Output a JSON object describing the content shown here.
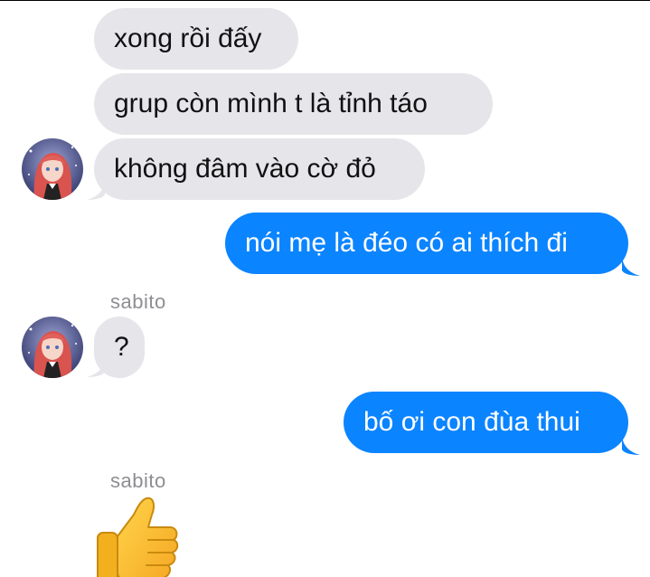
{
  "conversation": {
    "messages": [
      {
        "direction": "in",
        "text": "xong rồi đấy"
      },
      {
        "direction": "in",
        "text": "grup còn mình t là tỉnh táo"
      },
      {
        "direction": "in",
        "text": "không đâm vào cờ đỏ"
      },
      {
        "direction": "out",
        "text": "nói mẹ là đéo có ai thích đi"
      },
      {
        "direction": "in",
        "sender": "sabito",
        "text": "?"
      },
      {
        "direction": "out",
        "text": "bố ơi con đùa thui"
      },
      {
        "direction": "in",
        "sender": "sabito",
        "emoji": "thumbs-up"
      }
    ]
  },
  "theme": {
    "incoming_bubble": "#e5e5ea",
    "outgoing_bubble": "#0b84ff",
    "sender_label": "#8e8e93"
  },
  "icons": {
    "avatar": "contact-avatar-icon",
    "thumbs_up": "thumbs-up-icon"
  }
}
